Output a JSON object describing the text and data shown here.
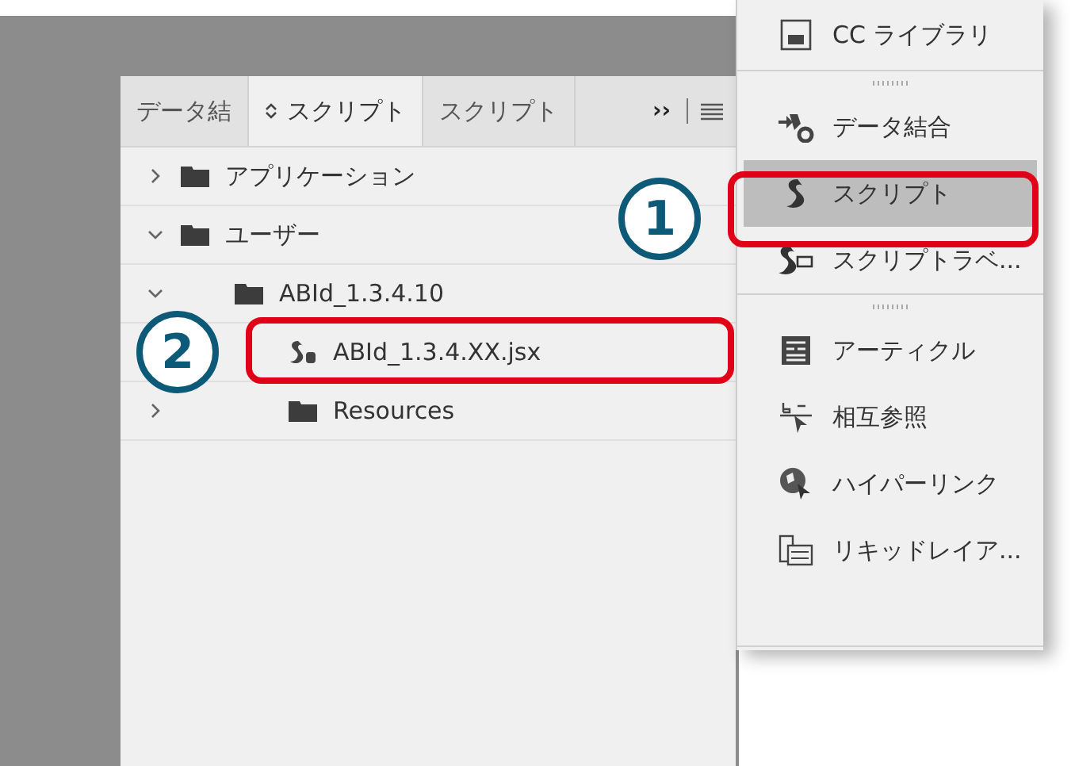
{
  "panel": {
    "tabs": [
      {
        "label": "データ結",
        "selected": false,
        "sort_icon": false
      },
      {
        "label": "スクリプト",
        "selected": true,
        "sort_icon": true
      },
      {
        "label": "スクリプト",
        "selected": false,
        "sort_icon": false
      }
    ],
    "tab_overflow": "››",
    "tree": [
      {
        "label": "アプリケーション",
        "kind": "folder",
        "expanded": false
      },
      {
        "label": "ユーザー",
        "kind": "folder",
        "expanded": true,
        "children": [
          {
            "label": "ABId_1.3.4.10",
            "kind": "folder",
            "expanded": true,
            "children": [
              {
                "label": "ABId_1.3.4.XX.jsx",
                "kind": "script"
              },
              {
                "label": "Resources",
                "kind": "folder",
                "expanded": false
              }
            ]
          }
        ]
      }
    ]
  },
  "menu": {
    "groups": [
      [
        {
          "label": "CC ライブラリ",
          "kind": "library",
          "selected": false
        }
      ],
      [
        {
          "label": "データ結合",
          "kind": "merge",
          "selected": false
        },
        {
          "label": "スクリプト",
          "kind": "script",
          "selected": true
        },
        {
          "label": "スクリプトラベ...",
          "kind": "scriptlabel",
          "selected": false
        }
      ],
      [
        {
          "label": "アーティクル",
          "kind": "article",
          "selected": false
        },
        {
          "label": "相互参照",
          "kind": "xref",
          "selected": false
        },
        {
          "label": "ハイパーリンク",
          "kind": "hyperlink",
          "selected": false
        },
        {
          "label": "リキッドレイア...",
          "kind": "liquid",
          "selected": false
        }
      ]
    ]
  },
  "callouts": [
    {
      "number": "1"
    },
    {
      "number": "2"
    }
  ]
}
